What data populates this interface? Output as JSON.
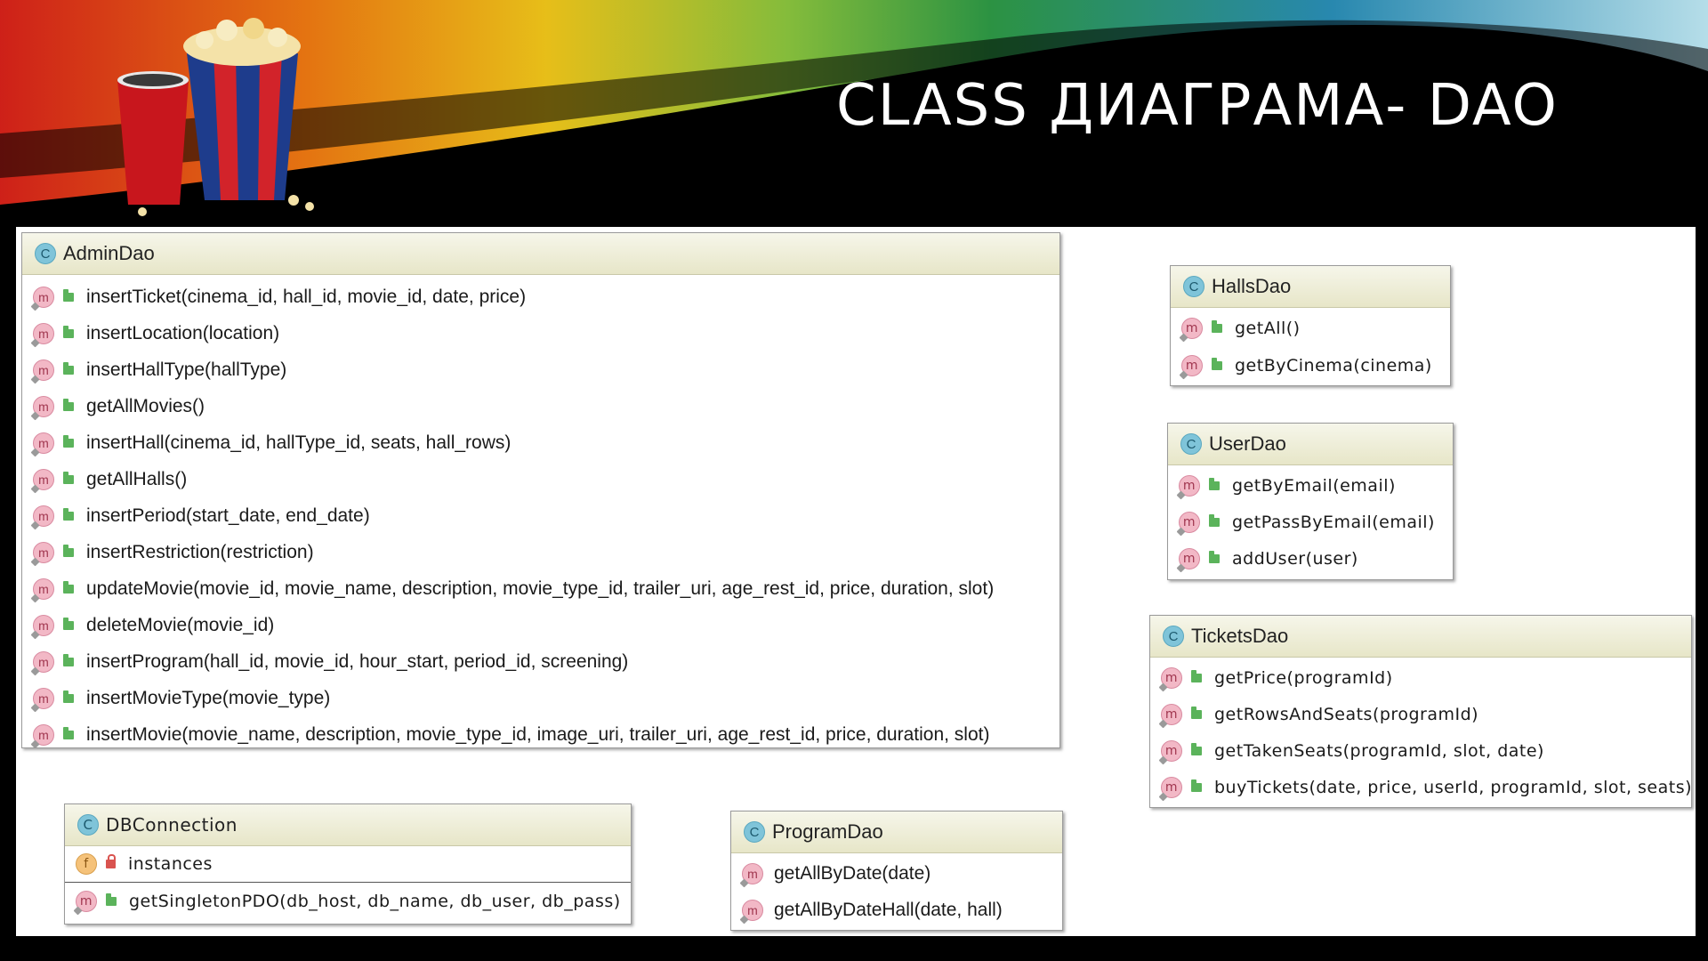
{
  "slide": {
    "title": "CLASS ДИАГРАМА- DAO"
  },
  "classes": {
    "admin_dao": {
      "name": "AdminDao",
      "methods": [
        "insertTicket(cinema_id, hall_id, movie_id, date, price)",
        "insertLocation(location)",
        "insertHallType(hallType)",
        "getAllMovies()",
        "insertHall(cinema_id, hallType_id, seats, hall_rows)",
        "getAllHalls()",
        "insertPeriod(start_date, end_date)",
        "insertRestriction(restriction)",
        "updateMovie(movie_id, movie_name, description, movie_type_id, trailer_uri, age_rest_id, price, duration, slot)",
        "deleteMovie(movie_id)",
        "insertProgram(hall_id, movie_id, hour_start, period_id, screening)",
        "insertMovieType(movie_type)",
        "insertMovie(movie_name, description, movie_type_id, image_uri, trailer_uri, age_rest_id, price, duration, slot)"
      ]
    },
    "halls_dao": {
      "name": "HallsDao",
      "methods": [
        "getAll()",
        "getByCinema(cinema)"
      ]
    },
    "user_dao": {
      "name": "UserDao",
      "methods": [
        "getByEmail(email)",
        "getPassByEmail(email)",
        "addUser(user)"
      ]
    },
    "tickets_dao": {
      "name": "TicketsDao",
      "methods": [
        "getPrice(programId)",
        "getRowsAndSeats(programId)",
        "getTakenSeats(programId, slot, date)",
        "buyTickets(date, price, userId, programId, slot, seats)"
      ]
    },
    "db_connection": {
      "name": "DBConnection",
      "fields": [
        "instances"
      ],
      "methods": [
        "getSingletonPDO(db_host, db_name, db_user, db_pass)"
      ]
    },
    "program_dao": {
      "name": "ProgramDao",
      "methods": [
        "getAllByDate(date)",
        "getAllByDateHall(date, hall)"
      ]
    }
  },
  "icons": {
    "class": "C",
    "method": "m",
    "field": "f"
  },
  "colors": {
    "header_bg": "#000000",
    "class_header": "#e7e6c8",
    "class_icon": "#7fc4d9",
    "method_icon": "#f2b8c6",
    "field_icon": "#f5c27a",
    "public_marker": "#5bb35b",
    "private_marker": "#d9534f"
  }
}
